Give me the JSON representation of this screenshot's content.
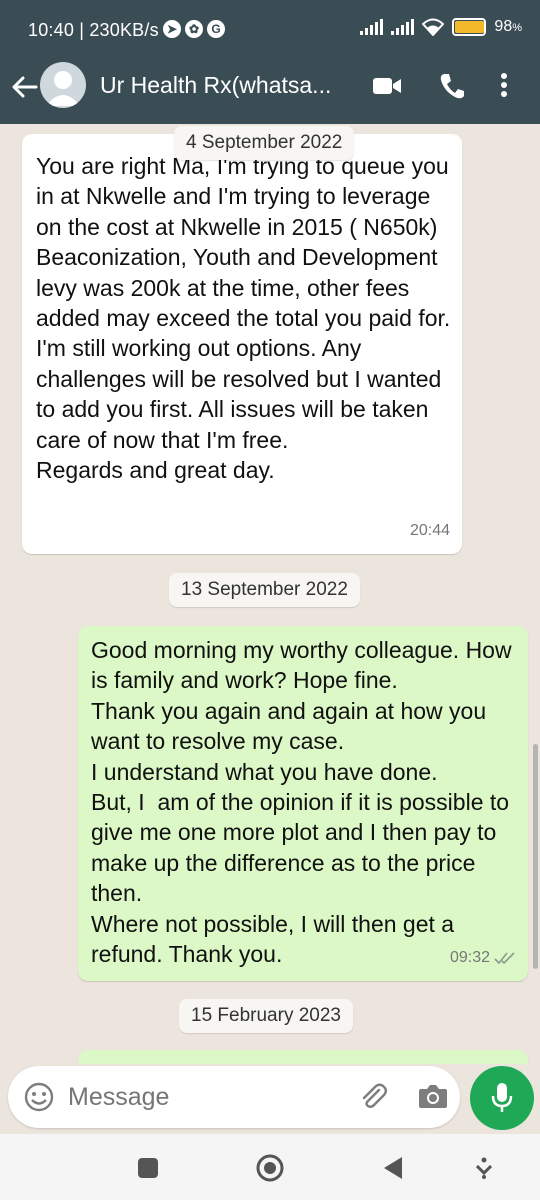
{
  "status": {
    "time_speed": "10:40 | 230KB/s",
    "battery": "98",
    "battery_level": 0.98,
    "icons": [
      "telegram-icon",
      "photos-icon",
      "google-icon",
      "signal-icon",
      "signal-icon",
      "wifi-icon",
      "battery-icon"
    ]
  },
  "header": {
    "title": "Ur Health Rx(whatsa...",
    "icons": [
      "back-arrow-icon",
      "avatar",
      "video-call-icon",
      "voice-call-icon",
      "more-options-icon"
    ]
  },
  "messages": [
    {
      "type": "date",
      "text": "4 September 2022"
    },
    {
      "type": "incoming",
      "text": "You are right Ma, I'm trying to queue you in at Nkwelle and I'm trying to leverage on the cost at Nkwelle in 2015 ( N650k)\nBeaconization, Youth and Development levy was 200k at the time, other fees added may exceed the total you paid for. I'm still working out options. Any challenges will be resolved but I wanted to add you first. All issues will be taken care of now that I'm free.\nRegards and great day.",
      "time": "20:44"
    },
    {
      "type": "date",
      "text": "13 September 2022"
    },
    {
      "type": "outgoing",
      "text": "Good morning my worthy colleague. How is family and work? Hope fine.\nThank you again and again at how you want to resolve my case.\nI understand what you have done.\nBut, I  am of the opinion if it is possible to give me one more plot and I then pay to make up the difference as to the price then.\nWhere not possible, I will then get a refund. Thank you.",
      "time": "09:32",
      "status_icon": "double-check-icon"
    },
    {
      "type": "date",
      "text": "15 February 2023"
    }
  ],
  "composer": {
    "placeholder": "Message",
    "icons": [
      "emoji-icon",
      "attach-icon",
      "camera-icon",
      "mic-icon"
    ]
  },
  "colors": {
    "header": "#3b4d54",
    "chat_bg": "#ece5dd",
    "outgoing_bubble": "#dcf8c6",
    "incoming_bubble": "#ffffff",
    "mic_button": "#1fa855",
    "battery_fill": "#f3b92b"
  },
  "navbar": {
    "icons": [
      "recent-apps-icon",
      "home-icon",
      "back-icon",
      "nav-menu-icon"
    ]
  }
}
